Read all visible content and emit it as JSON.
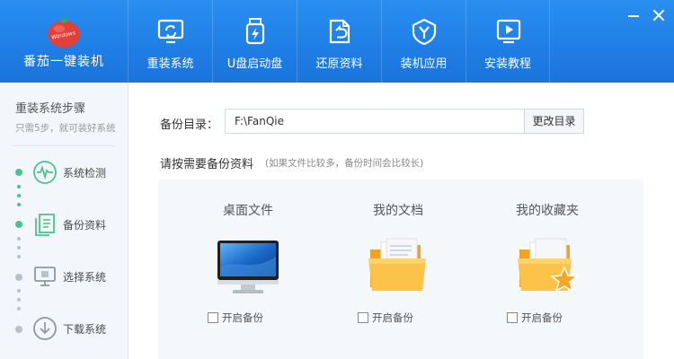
{
  "app": {
    "logo_title": "番茄一键装机",
    "logo_badge": "Windows"
  },
  "nav": {
    "items": [
      {
        "label": "重装系统",
        "icon": "monitor-refresh-icon"
      },
      {
        "label": "U盘启动盘",
        "icon": "usb-bolt-icon"
      },
      {
        "label": "还原资料",
        "icon": "folder-restore-icon"
      },
      {
        "label": "装机应用",
        "icon": "shield-y-icon"
      },
      {
        "label": "安装教程",
        "icon": "play-box-icon"
      }
    ]
  },
  "window": {
    "minimize_icon": "minimize-icon",
    "close_icon": "close-icon"
  },
  "sidebar": {
    "title": "重装系统步骤",
    "subtitle": "只需5步，就可装好系统",
    "steps": [
      {
        "label": "系统检测",
        "icon": "pulse-icon",
        "status": "done"
      },
      {
        "label": "备份资料",
        "icon": "document-copy-icon",
        "status": "current"
      },
      {
        "label": "选择系统",
        "icon": "monitor-icon",
        "status": "pending"
      },
      {
        "label": "下载系统",
        "icon": "download-icon",
        "status": "pending"
      }
    ]
  },
  "backup": {
    "dir_label": "备份目录：",
    "dir_value": "F:\\FanQie",
    "change_button": "更改目录",
    "section_title": "请按需要备份资料",
    "section_hint": "(如果文件比较多，备份时间会比较长)"
  },
  "cards": [
    {
      "title": "桌面文件",
      "checkbox_label": "开启备份",
      "checked": false,
      "icon": "desktop-monitor-icon"
    },
    {
      "title": "我的文档",
      "checkbox_label": "开启备份",
      "checked": false,
      "icon": "documents-folder-icon"
    },
    {
      "title": "我的收藏夹",
      "checkbox_label": "开启备份",
      "checked": false,
      "icon": "favorites-folder-icon"
    }
  ],
  "colors": {
    "header_blue": "#1f7fe6",
    "step_green": "#4cc38a",
    "folder_orange": "#f8b93a"
  }
}
